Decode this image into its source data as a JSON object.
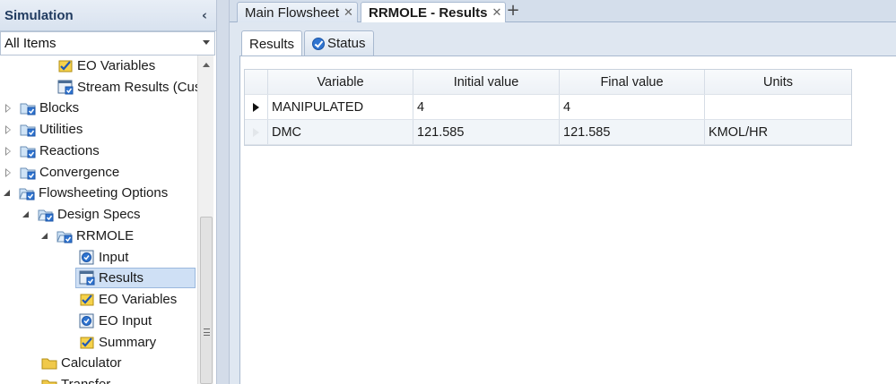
{
  "navigation": {
    "title": "Simulation",
    "filter_value": "All Items",
    "items": [
      {
        "label": "EO Variables",
        "icon": "eo-variables-check-icon"
      },
      {
        "label": "Stream Results (Cus",
        "icon": "results-form-icon"
      },
      {
        "label": "Blocks",
        "icon": "folder-check-icon"
      },
      {
        "label": "Utilities",
        "icon": "folder-check-icon"
      },
      {
        "label": "Reactions",
        "icon": "folder-check-icon"
      },
      {
        "label": "Convergence",
        "icon": "folder-check-icon"
      },
      {
        "label": "Flowsheeting Options",
        "icon": "folder-check-icon"
      },
      {
        "label": "Design Specs",
        "icon": "open-folder-check-icon"
      },
      {
        "label": "RRMOLE",
        "icon": "open-folder-check-icon"
      },
      {
        "label": "Input",
        "icon": "form-check-icon"
      },
      {
        "label": "Results",
        "icon": "results-form-icon"
      },
      {
        "label": "EO Variables",
        "icon": "eo-variables-check-icon"
      },
      {
        "label": "EO Input",
        "icon": "form-check-icon"
      },
      {
        "label": "Summary",
        "icon": "eo-variables-check-icon"
      },
      {
        "label": "Calculator",
        "icon": "folder-icon"
      },
      {
        "label": "Transfer",
        "icon": "folder-icon"
      }
    ]
  },
  "document_tabs": [
    {
      "label": "Main Flowsheet",
      "active": false
    },
    {
      "label": "RRMOLE - Results",
      "active": true
    }
  ],
  "form_tabs": [
    {
      "label": "Results",
      "active": true
    },
    {
      "label": "Status",
      "active": false,
      "icon": "status-check-icon"
    }
  ],
  "results_table": {
    "columns": [
      "Variable",
      "Initial value",
      "Final value",
      "Units"
    ],
    "rows": [
      {
        "variable": "MANIPULATED",
        "initial": "4",
        "final": "4",
        "units": ""
      },
      {
        "variable": "DMC",
        "initial": "121.585",
        "final": "121.585",
        "units": "KMOL/HR"
      }
    ]
  },
  "colors": {
    "header_blue": "#1f3a5f",
    "selection": "#cfe0f5",
    "check_blue": "#2f74d0",
    "folder_yellow": "#f0c94a"
  }
}
